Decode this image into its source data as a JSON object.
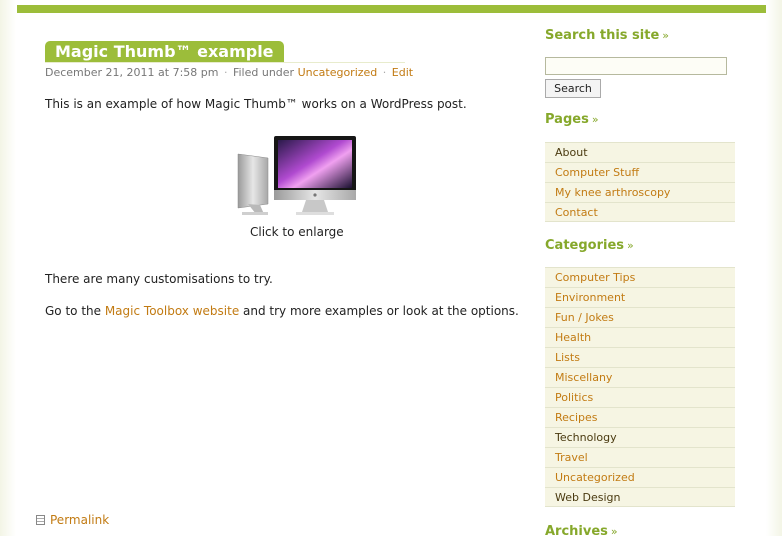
{
  "post": {
    "title": "Magic Thumb™ example",
    "date": "December 21, 2011 at 7:58 pm",
    "sep1": "·",
    "filed_label": "Filed under",
    "category": "Uncategorized",
    "sep2": "·",
    "edit": "Edit",
    "paragraph1": "This is an example of how Magic Thumb™ works on a WordPress post.",
    "image_caption": "Click to enlarge",
    "paragraph2": "There are many customisations to try.",
    "paragraph3_prefix": "Go to the ",
    "paragraph3_link": "Magic Toolbox website",
    "paragraph3_suffix": " and try more examples or look at the options.",
    "permalink": "Permalink"
  },
  "sidebar": {
    "search_title": "Search this site",
    "search_placeholder": "",
    "search_button": "Search",
    "pages_title": "Pages",
    "pages": [
      "About",
      "Computer Stuff",
      "My knee arthroscopy",
      "Contact"
    ],
    "categories_title": "Categories",
    "categories": [
      "Computer Tips",
      "Environment",
      "Fun / Jokes",
      "Health",
      "Lists",
      "Miscellany",
      "Politics",
      "Recipes",
      "Technology",
      "Travel",
      "Uncategorized",
      "Web Design"
    ],
    "archives_title": "Archives",
    "raquo": "»"
  },
  "colors": {
    "accent_green": "#9cbd3a",
    "heading_green": "#86a82b",
    "link_orange": "#c27b13"
  }
}
